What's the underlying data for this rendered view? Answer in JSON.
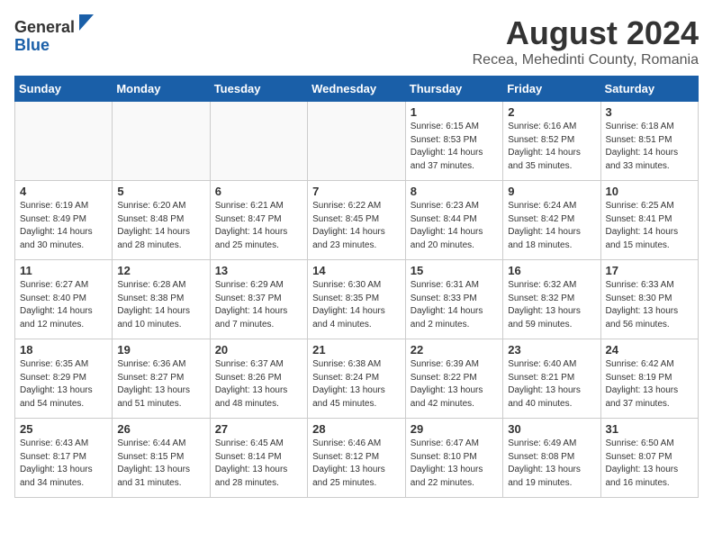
{
  "header": {
    "logo_general": "General",
    "logo_blue": "Blue",
    "main_title": "August 2024",
    "subtitle": "Recea, Mehedinti County, Romania"
  },
  "calendar": {
    "days_of_week": [
      "Sunday",
      "Monday",
      "Tuesday",
      "Wednesday",
      "Thursday",
      "Friday",
      "Saturday"
    ],
    "weeks": [
      [
        {
          "day": "",
          "info": ""
        },
        {
          "day": "",
          "info": ""
        },
        {
          "day": "",
          "info": ""
        },
        {
          "day": "",
          "info": ""
        },
        {
          "day": "1",
          "info": "Sunrise: 6:15 AM\nSunset: 8:53 PM\nDaylight: 14 hours and 37 minutes."
        },
        {
          "day": "2",
          "info": "Sunrise: 6:16 AM\nSunset: 8:52 PM\nDaylight: 14 hours and 35 minutes."
        },
        {
          "day": "3",
          "info": "Sunrise: 6:18 AM\nSunset: 8:51 PM\nDaylight: 14 hours and 33 minutes."
        }
      ],
      [
        {
          "day": "4",
          "info": "Sunrise: 6:19 AM\nSunset: 8:49 PM\nDaylight: 14 hours and 30 minutes."
        },
        {
          "day": "5",
          "info": "Sunrise: 6:20 AM\nSunset: 8:48 PM\nDaylight: 14 hours and 28 minutes."
        },
        {
          "day": "6",
          "info": "Sunrise: 6:21 AM\nSunset: 8:47 PM\nDaylight: 14 hours and 25 minutes."
        },
        {
          "day": "7",
          "info": "Sunrise: 6:22 AM\nSunset: 8:45 PM\nDaylight: 14 hours and 23 minutes."
        },
        {
          "day": "8",
          "info": "Sunrise: 6:23 AM\nSunset: 8:44 PM\nDaylight: 14 hours and 20 minutes."
        },
        {
          "day": "9",
          "info": "Sunrise: 6:24 AM\nSunset: 8:42 PM\nDaylight: 14 hours and 18 minutes."
        },
        {
          "day": "10",
          "info": "Sunrise: 6:25 AM\nSunset: 8:41 PM\nDaylight: 14 hours and 15 minutes."
        }
      ],
      [
        {
          "day": "11",
          "info": "Sunrise: 6:27 AM\nSunset: 8:40 PM\nDaylight: 14 hours and 12 minutes."
        },
        {
          "day": "12",
          "info": "Sunrise: 6:28 AM\nSunset: 8:38 PM\nDaylight: 14 hours and 10 minutes."
        },
        {
          "day": "13",
          "info": "Sunrise: 6:29 AM\nSunset: 8:37 PM\nDaylight: 14 hours and 7 minutes."
        },
        {
          "day": "14",
          "info": "Sunrise: 6:30 AM\nSunset: 8:35 PM\nDaylight: 14 hours and 4 minutes."
        },
        {
          "day": "15",
          "info": "Sunrise: 6:31 AM\nSunset: 8:33 PM\nDaylight: 14 hours and 2 minutes."
        },
        {
          "day": "16",
          "info": "Sunrise: 6:32 AM\nSunset: 8:32 PM\nDaylight: 13 hours and 59 minutes."
        },
        {
          "day": "17",
          "info": "Sunrise: 6:33 AM\nSunset: 8:30 PM\nDaylight: 13 hours and 56 minutes."
        }
      ],
      [
        {
          "day": "18",
          "info": "Sunrise: 6:35 AM\nSunset: 8:29 PM\nDaylight: 13 hours and 54 minutes."
        },
        {
          "day": "19",
          "info": "Sunrise: 6:36 AM\nSunset: 8:27 PM\nDaylight: 13 hours and 51 minutes."
        },
        {
          "day": "20",
          "info": "Sunrise: 6:37 AM\nSunset: 8:26 PM\nDaylight: 13 hours and 48 minutes."
        },
        {
          "day": "21",
          "info": "Sunrise: 6:38 AM\nSunset: 8:24 PM\nDaylight: 13 hours and 45 minutes."
        },
        {
          "day": "22",
          "info": "Sunrise: 6:39 AM\nSunset: 8:22 PM\nDaylight: 13 hours and 42 minutes."
        },
        {
          "day": "23",
          "info": "Sunrise: 6:40 AM\nSunset: 8:21 PM\nDaylight: 13 hours and 40 minutes."
        },
        {
          "day": "24",
          "info": "Sunrise: 6:42 AM\nSunset: 8:19 PM\nDaylight: 13 hours and 37 minutes."
        }
      ],
      [
        {
          "day": "25",
          "info": "Sunrise: 6:43 AM\nSunset: 8:17 PM\nDaylight: 13 hours and 34 minutes."
        },
        {
          "day": "26",
          "info": "Sunrise: 6:44 AM\nSunset: 8:15 PM\nDaylight: 13 hours and 31 minutes."
        },
        {
          "day": "27",
          "info": "Sunrise: 6:45 AM\nSunset: 8:14 PM\nDaylight: 13 hours and 28 minutes."
        },
        {
          "day": "28",
          "info": "Sunrise: 6:46 AM\nSunset: 8:12 PM\nDaylight: 13 hours and 25 minutes."
        },
        {
          "day": "29",
          "info": "Sunrise: 6:47 AM\nSunset: 8:10 PM\nDaylight: 13 hours and 22 minutes."
        },
        {
          "day": "30",
          "info": "Sunrise: 6:49 AM\nSunset: 8:08 PM\nDaylight: 13 hours and 19 minutes."
        },
        {
          "day": "31",
          "info": "Sunrise: 6:50 AM\nSunset: 8:07 PM\nDaylight: 13 hours and 16 minutes."
        }
      ]
    ]
  }
}
